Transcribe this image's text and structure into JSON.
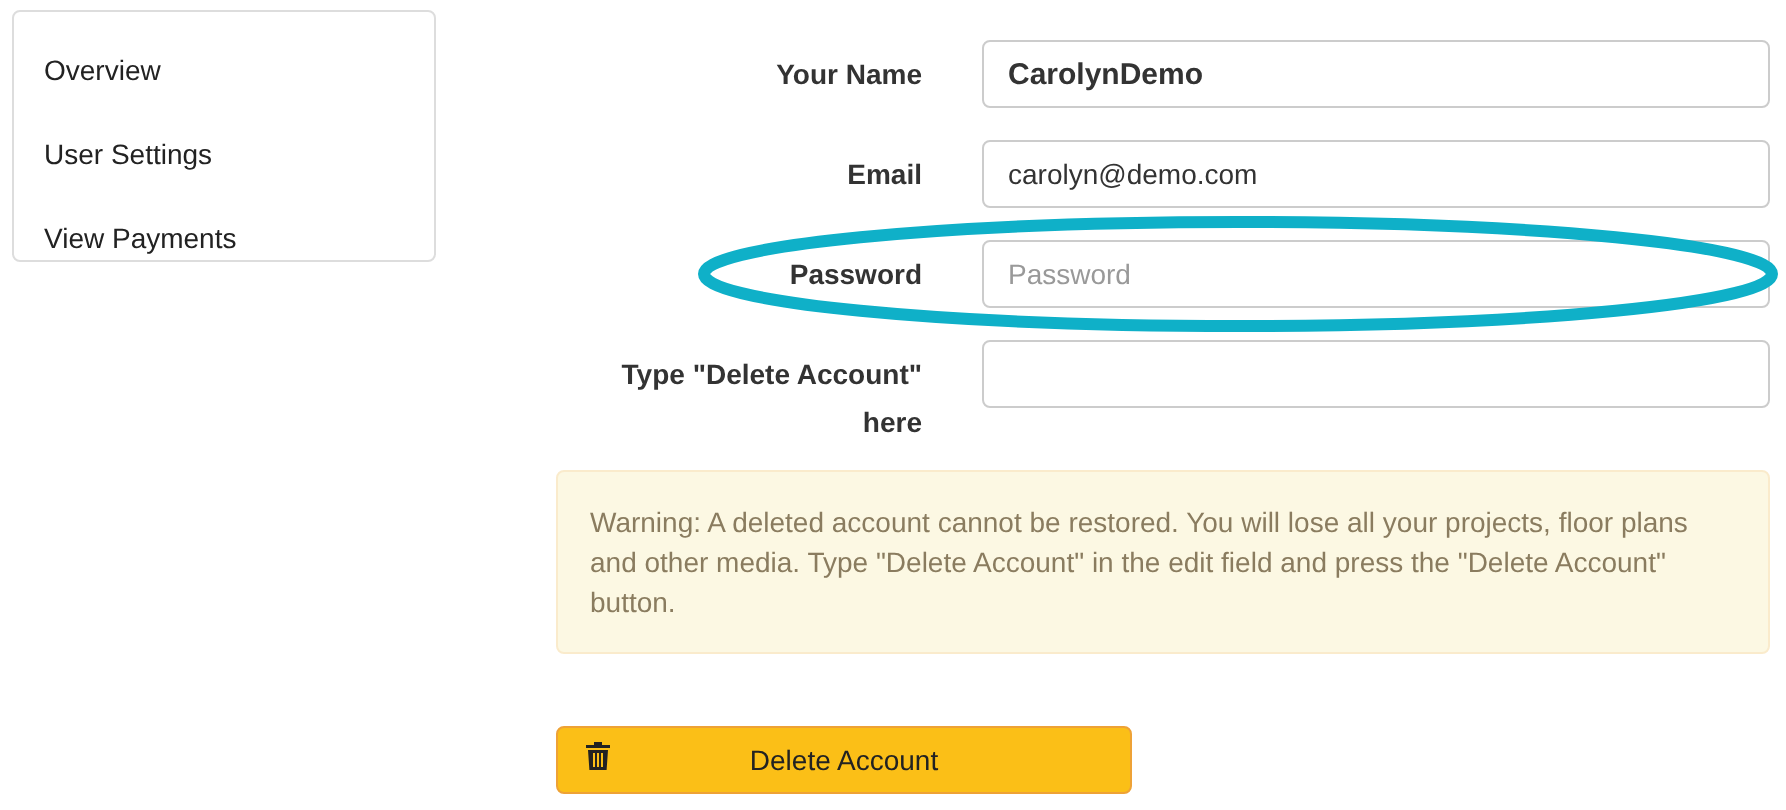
{
  "sidebar": {
    "items": [
      {
        "label": "Overview"
      },
      {
        "label": "User Settings"
      },
      {
        "label": "View Payments"
      }
    ]
  },
  "form": {
    "fields": [
      {
        "label": "Your Name",
        "value": "CarolynDemo",
        "bold": true,
        "highlighted": false
      },
      {
        "label": "Email",
        "value": "carolyn@demo.com",
        "bold": false,
        "highlighted": false
      },
      {
        "label": "Password",
        "placeholder": "Password",
        "bold": false,
        "highlighted": true
      },
      {
        "label": "Type \"Delete Account\" here",
        "highlighted": false
      }
    ],
    "warning": "Warning: A deleted account cannot be restored. You will lose all your projects, floor plans and other media. Type \"Delete Account\" in the edit field and press the \"Delete Account\" button.",
    "button": "Delete Account"
  }
}
